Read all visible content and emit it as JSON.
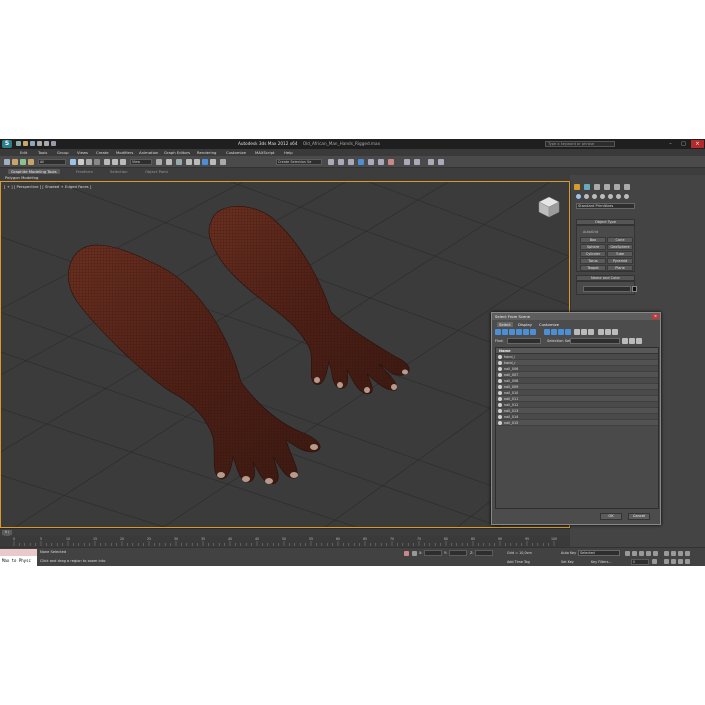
{
  "title_bar": {
    "app_title": "Autodesk 3ds Max 2012 x64",
    "file_name": "Old_African_Man_Hands_Rigged.max",
    "search_placeholder": "Type a keyword or phrase",
    "minimize": "–",
    "maximize": "□",
    "close": "×"
  },
  "menus": [
    "Edit",
    "Tools",
    "Group",
    "Views",
    "Create",
    "Modifiers",
    "Animation",
    "Graph Editors",
    "Rendering",
    "Customize",
    "MAXScript",
    "Help"
  ],
  "toolbar": {
    "selection_filter": "All",
    "reference_coord": "View",
    "named_selection_sets": "Create Selection Se"
  },
  "ribbon": {
    "tabs": [
      "Graphite Modeling Tools",
      "Freeform",
      "Selection",
      "Object Paint"
    ],
    "active_tab": "Graphite Modeling Tools",
    "sub_label": "Polygon Modeling"
  },
  "viewport": {
    "label": "[ + ] [ Perspective ] [ Shaded + Edged Faces ]"
  },
  "command_panel": {
    "category_dropdown": "Standard Primitives",
    "object_type_title": "Object Type",
    "autogrid_label": "AutoGrid",
    "object_buttons": [
      "Box",
      "Cone",
      "Sphere",
      "GeoSphere",
      "Cylinder",
      "Tube",
      "Torus",
      "Pyramid",
      "Teapot",
      "Plane"
    ],
    "name_and_color_title": "Name and Color"
  },
  "select_dialog": {
    "title": "Select From Scene",
    "close": "×",
    "menu": [
      "Select",
      "Display",
      "Customize"
    ],
    "find_label": "Find:",
    "selection_sets_label": "Selection Set:",
    "column_name": "Name",
    "rows": [
      "hand_l",
      "hand_r",
      "nail_006",
      "nail_007",
      "nail_008",
      "nail_009",
      "nail_010",
      "nail_011",
      "nail_012",
      "nail_013",
      "nail_014",
      "nail_015"
    ],
    "ok_label": "OK",
    "cancel_label": "Cancel"
  },
  "timeline": {
    "frame_display": "0 / 100",
    "ticks": [
      "0",
      "5",
      "10",
      "15",
      "20",
      "25",
      "30",
      "35",
      "40",
      "45",
      "50",
      "55",
      "60",
      "65",
      "70",
      "75",
      "80",
      "85",
      "90",
      "95",
      "100"
    ]
  },
  "status": {
    "maxscript_text": "Max to Physc",
    "selection_status": "None Selected",
    "prompt": "Click and drag a region to zoom into",
    "x_label": "X:",
    "y_label": "Y:",
    "z_label": "Z:",
    "grid": "Grid = 10,0cm",
    "add_time_tag": "Add Time Tag",
    "auto_key": "Auto Key",
    "selected_dropdown": "Selected",
    "set_key": "Set Key",
    "key_filters": "Key Filters...",
    "frame_field": "0"
  },
  "colors": {
    "accent_border": "#d89a2a",
    "skin": "#5a2a1f",
    "close_red": "#c03b3b"
  }
}
